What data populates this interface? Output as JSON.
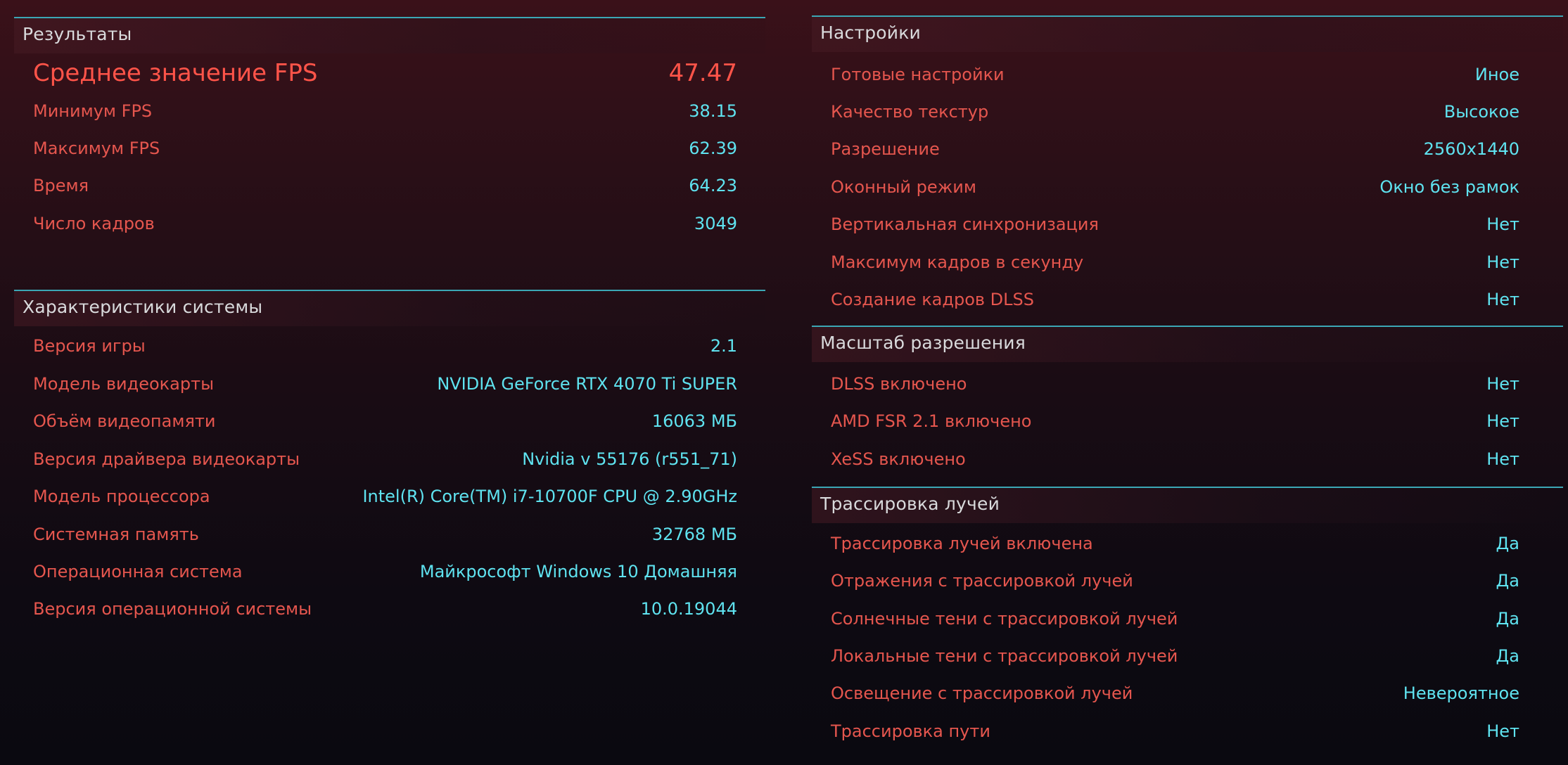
{
  "results": {
    "title": "Результаты",
    "avg_fps": {
      "label": "Среднее значение FPS",
      "value": "47.47"
    },
    "rows": [
      {
        "label": "Минимум FPS",
        "value": "38.15"
      },
      {
        "label": "Максимум FPS",
        "value": "62.39"
      },
      {
        "label": "Время",
        "value": "64.23"
      },
      {
        "label": "Число кадров",
        "value": "3049"
      }
    ]
  },
  "system": {
    "title": "Характеристики системы",
    "rows": [
      {
        "label": "Версия игры",
        "value": "2.1"
      },
      {
        "label": "Модель видеокарты",
        "value": "NVIDIA GeForce RTX 4070 Ti SUPER"
      },
      {
        "label": "Объём видеопамяти",
        "value": "16063 МБ"
      },
      {
        "label": "Версия драйвера видеокарты",
        "value": "Nvidia v 55176 (r551_71)"
      },
      {
        "label": "Модель процессора",
        "value": "Intel(R) Core(TM) i7-10700F CPU @ 2.90GHz"
      },
      {
        "label": "Системная память",
        "value": "32768 МБ"
      },
      {
        "label": "Операционная система",
        "value": "Майкрософт Windows 10 Домашняя"
      },
      {
        "label": "Версия операционной системы",
        "value": "10.0.19044"
      }
    ]
  },
  "settings": {
    "title": "Настройки",
    "rows": [
      {
        "label": "Готовые настройки",
        "value": "Иное"
      },
      {
        "label": "Качество текстур",
        "value": "Высокое"
      },
      {
        "label": "Разрешение",
        "value": "2560x1440"
      },
      {
        "label": "Оконный режим",
        "value": "Окно без рамок"
      },
      {
        "label": "Вертикальная синхронизация",
        "value": "Нет"
      },
      {
        "label": "Максимум кадров в секунду",
        "value": "Нет"
      },
      {
        "label": "Создание кадров DLSS",
        "value": "Нет"
      }
    ]
  },
  "scaling": {
    "title": "Масштаб разрешения",
    "rows": [
      {
        "label": "DLSS включено",
        "value": "Нет"
      },
      {
        "label": "AMD FSR 2.1 включено",
        "value": "Нет"
      },
      {
        "label": "XeSS включено",
        "value": "Нет"
      }
    ]
  },
  "raytracing": {
    "title": "Трассировка лучей",
    "rows": [
      {
        "label": "Трассировка лучей включена",
        "value": "Да"
      },
      {
        "label": "Отражения с трассировкой лучей",
        "value": "Да"
      },
      {
        "label": "Солнечные тени с трассировкой лучей",
        "value": "Да"
      },
      {
        "label": "Локальные тени с трассировкой лучей",
        "value": "Да"
      },
      {
        "label": "Освещение с трассировкой лучей",
        "value": "Невероятное"
      },
      {
        "label": "Трассировка пути",
        "value": "Нет"
      }
    ]
  }
}
